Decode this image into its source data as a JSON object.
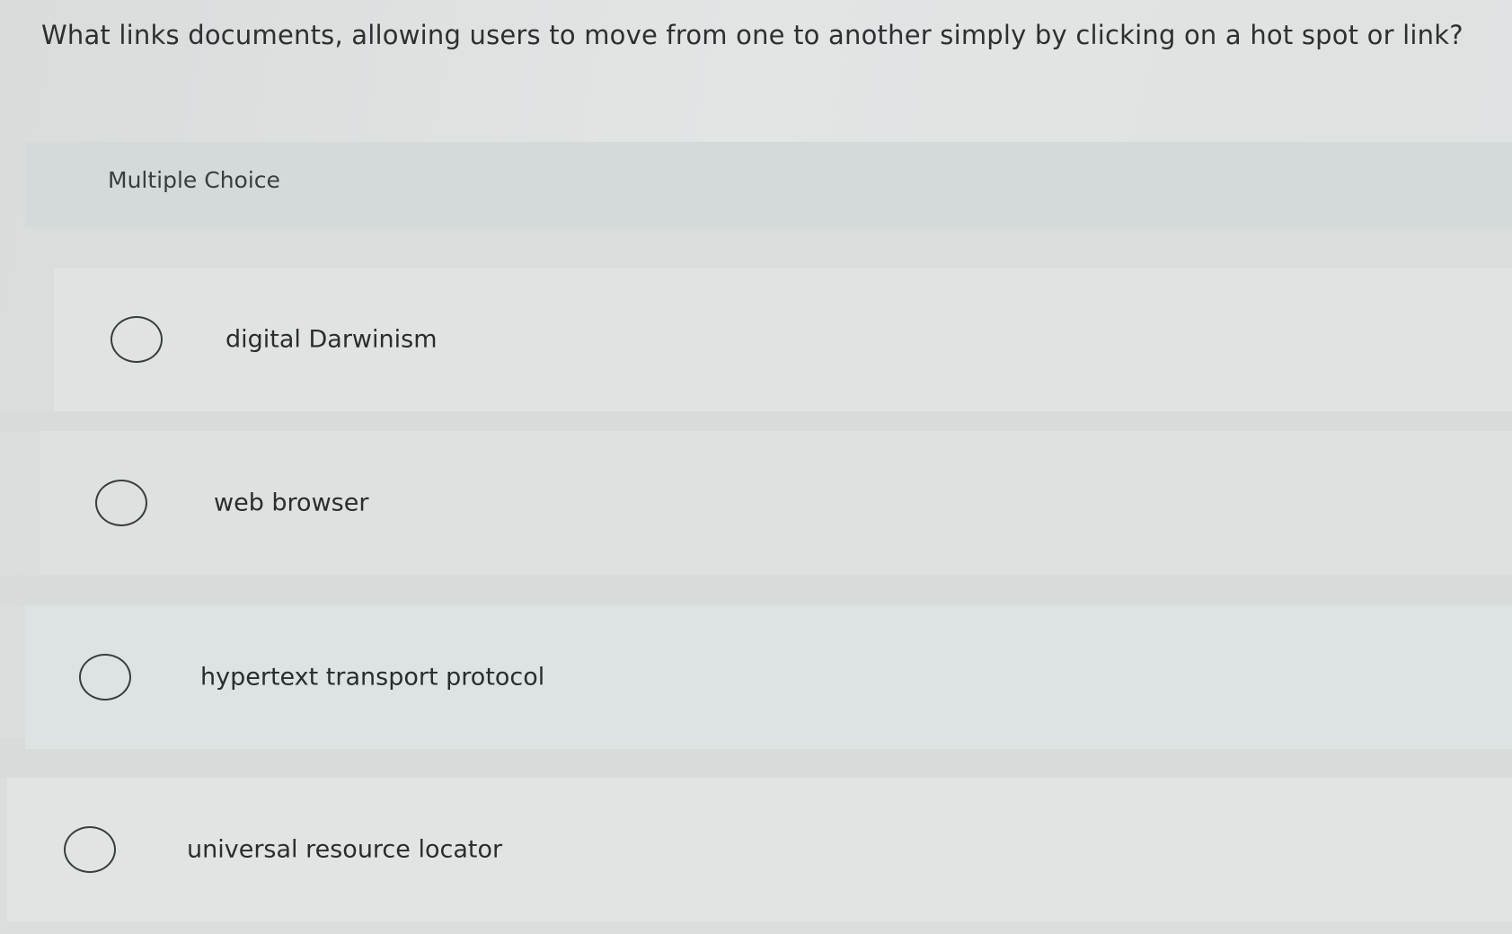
{
  "question": {
    "text": "What links documents, allowing users to move from one to another simply by clicking on a hot spot or link?"
  },
  "multiple_choice": {
    "label": "Multiple Choice",
    "options": [
      {
        "label": "digital Darwinism"
      },
      {
        "label": "web browser"
      },
      {
        "label": "hypertext transport protocol"
      },
      {
        "label": "universal resource locator"
      }
    ]
  }
}
